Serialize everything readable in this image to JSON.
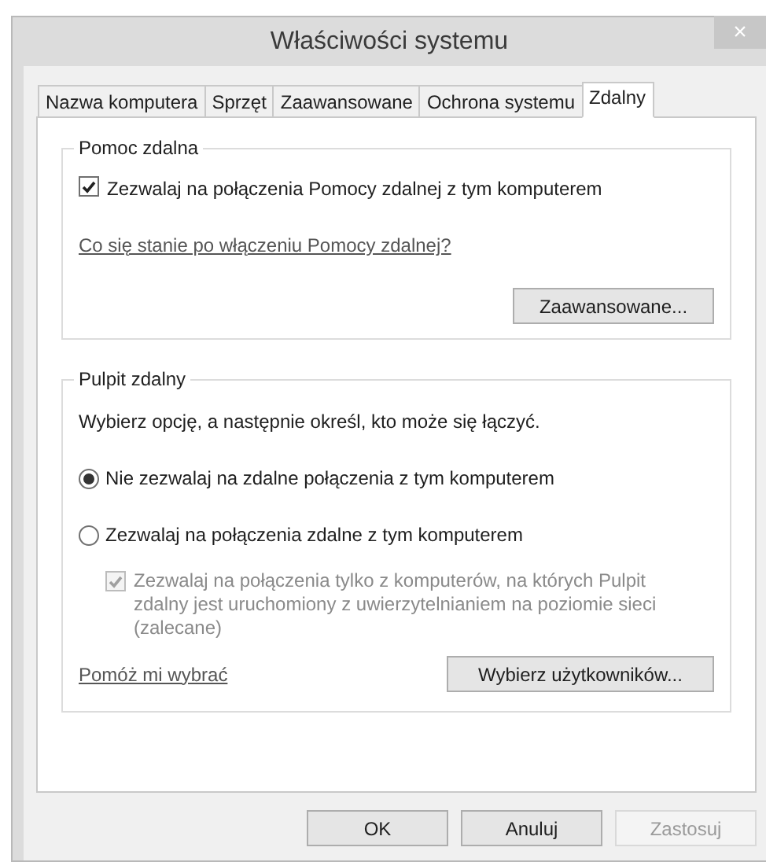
{
  "window": {
    "title": "Właściwości systemu",
    "close": "×"
  },
  "tabs": [
    {
      "label": "Nazwa komputera",
      "selected": false
    },
    {
      "label": "Sprzęt",
      "selected": false
    },
    {
      "label": "Zaawansowane",
      "selected": false
    },
    {
      "label": "Ochrona systemu",
      "selected": false
    },
    {
      "label": "Zdalny",
      "selected": true
    }
  ],
  "remote_assistance": {
    "title": "Pomoc zdalna",
    "checkbox": {
      "label": "Zezwalaj na połączenia Pomocy zdalnej z tym komputerem",
      "checked": true,
      "disabled": false
    },
    "link": "Co się stanie po włączeniu Pomocy zdalnej?",
    "button": "Zaawansowane..."
  },
  "remote_desktop": {
    "title": "Pulpit zdalny",
    "instruction": "Wybierz opcję, a następnie określ, kto może się łączyć.",
    "options": [
      {
        "label": "Nie zezwalaj na zdalne połączenia z tym komputerem",
        "selected": true
      },
      {
        "label": "Zezwalaj na połączenia zdalne z tym komputerem",
        "selected": false
      }
    ],
    "nla_checkbox": {
      "label": "Zezwalaj na połączenia tylko z komputerów, na których Pulpit zdalny jest uruchomiony z uwierzytelnianiem na poziomie sieci (zalecane)",
      "checked": true,
      "disabled": true
    },
    "help_link": "Pomóż mi wybrać",
    "button": "Wybierz użytkowników..."
  },
  "buttons": [
    {
      "label": "OK",
      "disabled": false
    },
    {
      "label": "Anuluj",
      "disabled": false
    },
    {
      "label": "Zastosuj",
      "disabled": true
    }
  ]
}
